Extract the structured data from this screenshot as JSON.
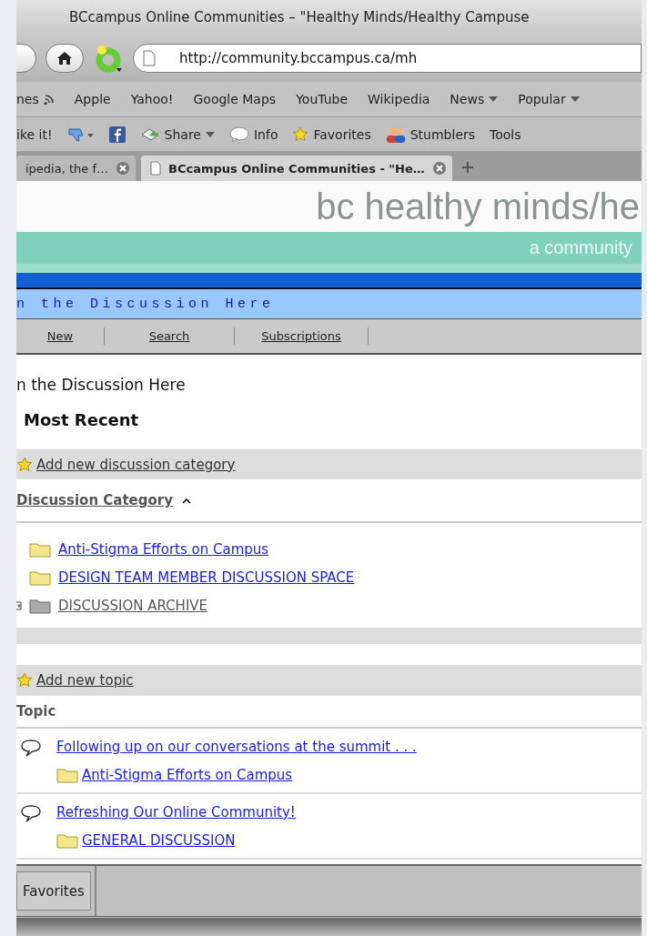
{
  "window": {
    "title": "BCcampus Online Communities – \"Healthy Minds/Healthy Campuse"
  },
  "address_bar": {
    "url": "http://community.bccampus.ca/mh"
  },
  "bookmarks": [
    {
      "label": "nes",
      "kind": "feed"
    },
    {
      "label": "Apple",
      "kind": "link"
    },
    {
      "label": "Yahoo!",
      "kind": "link"
    },
    {
      "label": "Google Maps",
      "kind": "link"
    },
    {
      "label": "YouTube",
      "kind": "link"
    },
    {
      "label": "Wikipedia",
      "kind": "link"
    },
    {
      "label": "News",
      "kind": "menu"
    },
    {
      "label": "Popular",
      "kind": "menu"
    }
  ],
  "toolbar": [
    {
      "label": "ike it!",
      "kind": "text"
    },
    {
      "kind": "thumb"
    },
    {
      "kind": "facebook"
    },
    {
      "label": "Share",
      "kind": "share"
    },
    {
      "label": "Info",
      "kind": "info"
    },
    {
      "label": "Favorites",
      "kind": "star"
    },
    {
      "label": "Stumblers",
      "kind": "people"
    },
    {
      "label": "Tools",
      "kind": "text"
    }
  ],
  "tabs": [
    {
      "label": "ipedia, the f…",
      "selected": false
    },
    {
      "label": "BCcampus Online Communities - \"He…",
      "selected": true
    }
  ],
  "site": {
    "title": "bc healthy minds/he",
    "tagline": "a community",
    "banner": "n the Discussion Here"
  },
  "nav": [
    "New",
    "Search",
    "Subscriptions"
  ],
  "page": {
    "intro": "n the Discussion Here",
    "heading": "Most Recent"
  },
  "categories": {
    "add_label": "Add new discussion category",
    "column": "Discussion Category",
    "items": [
      {
        "label": "Anti-Stigma Efforts on Campus",
        "archived": false
      },
      {
        "label": "DESIGN TEAM MEMBER DISCUSSION SPACE",
        "archived": false
      },
      {
        "label": "DISCUSSION ARCHIVE",
        "archived": true
      }
    ]
  },
  "topics": {
    "add_label": "Add new topic",
    "column": "Topic",
    "items": [
      {
        "title": "Following up on our conversations at the summit . . .",
        "category": "Anti-Stigma Efforts on Campus"
      },
      {
        "title": "Refreshing Our Online Community!",
        "category": "GENERAL DISCUSSION"
      }
    ]
  },
  "bottom_bar": {
    "button": "Favorites"
  }
}
